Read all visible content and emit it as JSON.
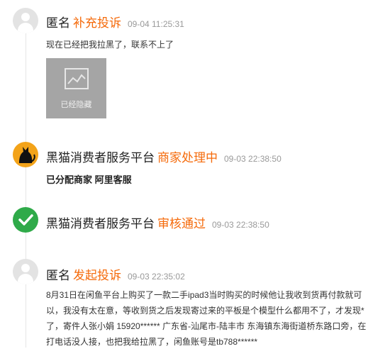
{
  "entries": [
    {
      "name": "匿名",
      "status": "补充投诉",
      "time": "09-04 11:25:31",
      "text": "现在已经把我拉黑了，联系不上了",
      "image_label": "已经隐藏"
    },
    {
      "name": "黑猫消费者服务平台",
      "status": "商家处理中",
      "time": "09-03 22:38:50",
      "text": "已分配商家 阿里客服"
    },
    {
      "name": "黑猫消费者服务平台",
      "status": "审核通过",
      "time": "09-03 22:38:50"
    },
    {
      "name": "匿名",
      "status": "发起投诉",
      "time": "09-03 22:35:02",
      "text_lines": [
        "8月31日在闲鱼平台上购买了一款二手ipad3当时购买的时候他让我收到货再付款就可",
        "以，我没有太在意，等收到货之后发现寄过来的平板是个模型什么都用不了，才发现*",
        "了，寄件人张小娟 15920****** 广东省-汕尾市-陆丰市 东海镇东海街道桥东路口旁，在",
        "打电话没人接，也把我给拉黑了，闲鱼账号是tb788******"
      ]
    }
  ],
  "colors": {
    "status": "#f56a0a",
    "check_avatar": "#2faa49",
    "cat_avatar": "#f3a319"
  },
  "icons": [
    "user-avatar-icon",
    "image-icon",
    "black-cat-logo-icon",
    "checkmark-icon"
  ]
}
